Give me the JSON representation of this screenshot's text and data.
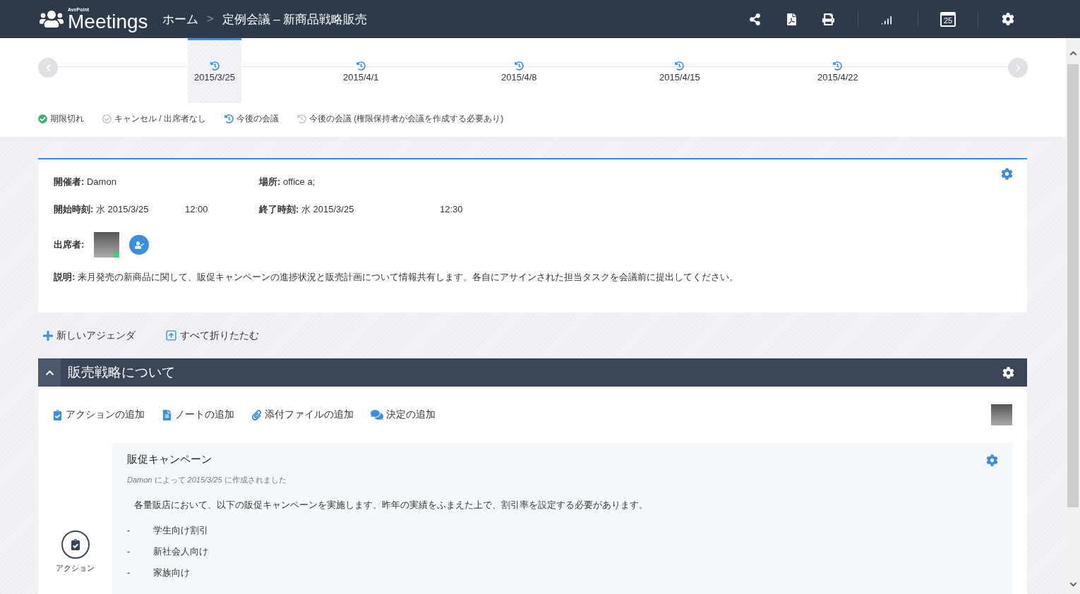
{
  "header": {
    "app_name": "Meetings",
    "brand": "AvePoint",
    "breadcrumb": [
      {
        "label": "ホーム"
      },
      {
        "label": "定例会議 – 新商品戦略販売"
      }
    ],
    "separator": ">",
    "calendar_day": "25"
  },
  "timeline": {
    "dates": [
      {
        "label": "2015/3/25",
        "selected": true
      },
      {
        "label": "2015/4/1",
        "selected": false
      },
      {
        "label": "2015/4/8",
        "selected": false
      },
      {
        "label": "2015/4/15",
        "selected": false
      },
      {
        "label": "2015/4/22",
        "selected": false
      }
    ],
    "legend": [
      {
        "kind": "expired",
        "label": "期限切れ"
      },
      {
        "kind": "cancelled",
        "label": "キャンセル / 出席者なし"
      },
      {
        "kind": "upcoming",
        "label": "今後の会議"
      },
      {
        "kind": "pending",
        "label": "今後の会議 (権限保持者が会議を作成する必要あり)"
      }
    ]
  },
  "meeting": {
    "organizer": "**開催者:** Damon",
    "location": "**場所:** office a;",
    "start": "**開始時刻:** 水 2015/3/25",
    "start_time": "12:00",
    "end": "**終了時刻:** 水 2015/3/25",
    "end_time": "12:30",
    "attendees_label": "出席者:",
    "description": "**説明:** 来月発売の新商品に関して、販促キャンペーンの進捗状況と販売計画について情報共有します。各自にアサインされた担当タスクを会議前に提出してください。"
  },
  "agenda_toolbar": [
    {
      "kind": "add",
      "label": "新しいアジェンダ"
    },
    {
      "kind": "collapse",
      "label": "すべて折りたたむ"
    }
  ],
  "agenda": {
    "title": "販売戦略について",
    "expanded": true,
    "actions": [
      {
        "kind": "action",
        "label": "アクションの追加"
      },
      {
        "kind": "note",
        "label": "ノートの追加"
      },
      {
        "kind": "attachment",
        "label": "添付ファイルの追加"
      },
      {
        "kind": "decision",
        "label": "決定の追加"
      }
    ],
    "item": {
      "badge": "アクション",
      "title": "販促キャンペーン",
      "meta": "*Damon* によって *2015/3/25* に作成されました",
      "body": "各量販店において、以下の販促キャンペーンを実施します。昨年の実績をふまえた上で、割引率を設定する必要があります。",
      "list": [
        {
          "marker": "-",
          "text": "学生向け割引"
        },
        {
          "marker": "-",
          "text": "新社会人向け"
        },
        {
          "marker": "-",
          "text": "家族向け"
        }
      ]
    }
  }
}
